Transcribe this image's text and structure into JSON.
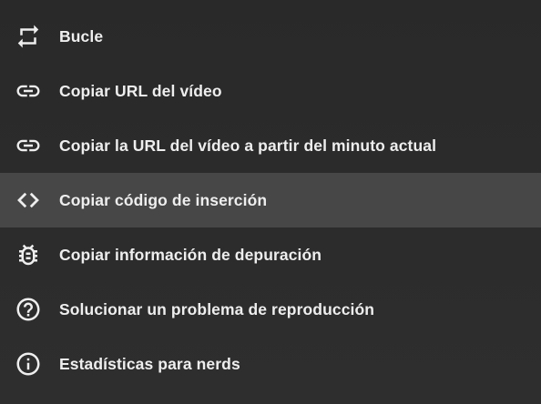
{
  "menu": {
    "items": [
      {
        "label": "Bucle",
        "icon": "loop-icon"
      },
      {
        "label": "Copiar URL del vídeo",
        "icon": "link-icon"
      },
      {
        "label": "Copiar la URL del vídeo a partir del minuto actual",
        "icon": "link-icon"
      },
      {
        "label": "Copiar código de inserción",
        "icon": "embed-code-icon"
      },
      {
        "label": "Copiar información de depuración",
        "icon": "bug-icon"
      },
      {
        "label": "Solucionar un problema de reproducción",
        "icon": "help-circle-icon"
      },
      {
        "label": "Estadísticas para nerds",
        "icon": "info-circle-icon"
      }
    ],
    "hovered_index": 3
  },
  "colors": {
    "background": "#2b2b2b",
    "hover": "#474747",
    "text": "#eeeeee"
  }
}
